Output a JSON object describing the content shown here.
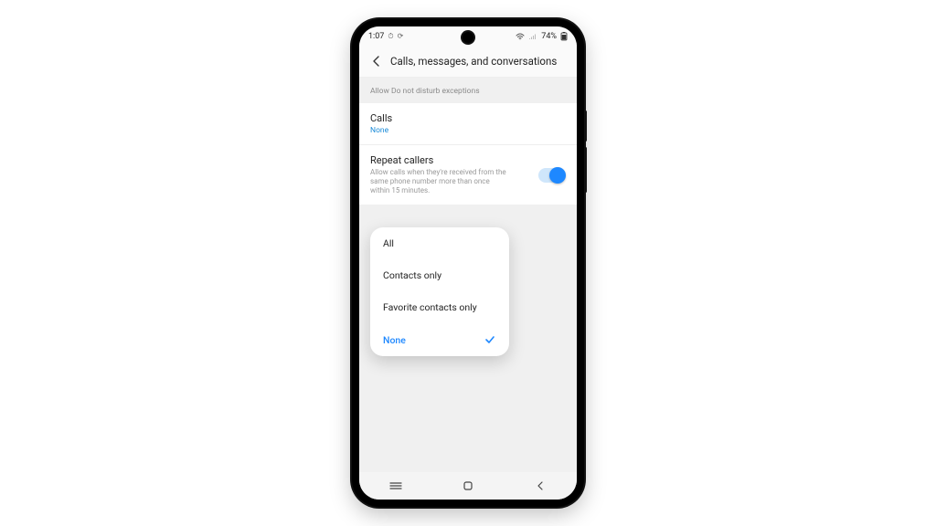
{
  "statusbar": {
    "time": "1:07",
    "alarm_glyph": "⏱",
    "orientation_glyph": "⟳",
    "battery_pct": "74%"
  },
  "header": {
    "title": "Calls, messages, and conversations"
  },
  "section": {
    "label": "Allow Do not disturb exceptions"
  },
  "items": {
    "calls": {
      "title": "Calls",
      "value": "None"
    },
    "repeat": {
      "title": "Repeat callers",
      "desc": "Allow calls when they're received from the same phone number more than once within 15 minutes.",
      "toggle_on": true
    }
  },
  "popup": {
    "options": [
      {
        "label": "All",
        "selected": false
      },
      {
        "label": "Contacts only",
        "selected": false
      },
      {
        "label": "Favorite contacts only",
        "selected": false
      },
      {
        "label": "None",
        "selected": true
      }
    ]
  }
}
